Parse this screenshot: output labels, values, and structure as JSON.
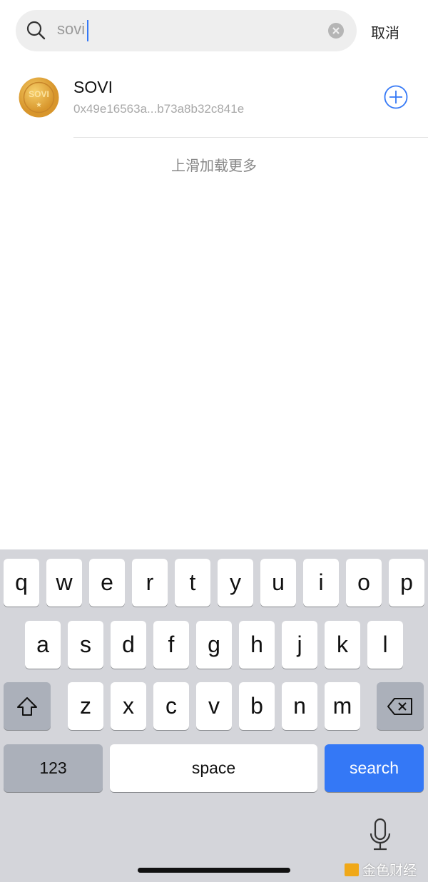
{
  "search": {
    "value": "sovi",
    "cancel_label": "取消"
  },
  "results": [
    {
      "symbol": "SOVI",
      "logo_text": "SOVI",
      "address": "0x49e16563a...b73a8b32c841e"
    }
  ],
  "load_more": "上滑加载更多",
  "keyboard": {
    "row1": [
      "q",
      "w",
      "e",
      "r",
      "t",
      "y",
      "u",
      "i",
      "o",
      "p"
    ],
    "row2": [
      "a",
      "s",
      "d",
      "f",
      "g",
      "h",
      "j",
      "k",
      "l"
    ],
    "row3": [
      "z",
      "x",
      "c",
      "v",
      "b",
      "n",
      "m"
    ],
    "numbers_label": "123",
    "space_label": "space",
    "search_label": "search"
  },
  "watermark": "金色财经",
  "colors": {
    "accent": "#3478f6",
    "coin": "#e0a53a"
  }
}
